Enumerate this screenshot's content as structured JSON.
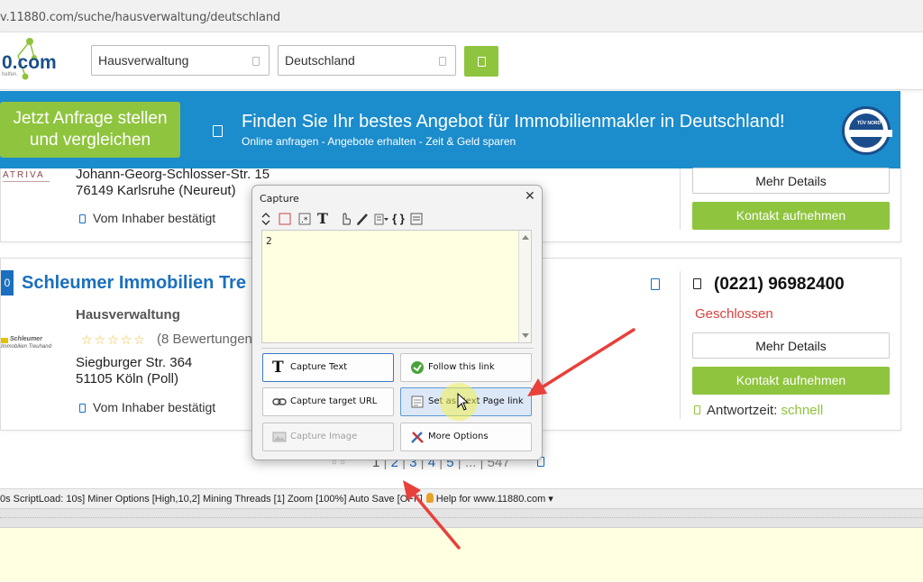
{
  "browser": {
    "url": "v.11880.com/suche/hausverwaltung/deutschland"
  },
  "header": {
    "logo_text": "0.com",
    "logo_tagline": "helfen.",
    "search_what": "Hausverwaltung",
    "search_where": "Deutschland"
  },
  "banner": {
    "button_label_1": "Jetzt Anfrage stellen",
    "button_label_2": "und vergleichen",
    "title": "Finden Sie Ihr bestes Angebot für Immobilienmakler in Deutschland!",
    "subtitle": "Online anfragen - Angebote erhalten - Zeit & Geld sparen",
    "badge_text": "TÜV NORD"
  },
  "listing1": {
    "logo_text": "ATRIVA",
    "street": "Johann-Georg-Schlosser-Str. 15",
    "city": "76149 Karlsruhe (Neureut)",
    "verified": "Vom Inhaber bestätigt",
    "details_button": "Mehr Details",
    "contact_button": "Kontakt aufnehmen"
  },
  "listing2": {
    "number": "0",
    "company": "Schleumer Immobilien Tre",
    "logo_line1": "Schleumer",
    "logo_line2": "Immobilien Treuhand",
    "category": "Hausverwaltung",
    "stars": "☆☆☆☆☆",
    "reviews": "(8 Bewertungen",
    "street": "Siegburger Str. 364",
    "city": "51105 Köln (Poll)",
    "verified": "Vom Inhaber bestätigt",
    "phone": "(0221) 96982400",
    "status": "Geschlossen",
    "details_button": "Mehr Details",
    "contact_button": "Kontakt aufnehmen",
    "response_label": "Antwortzeit:",
    "response_value": "schnell"
  },
  "pagination": {
    "pages": [
      "1",
      "2",
      "3",
      "4",
      "5",
      "...",
      "547"
    ]
  },
  "statusbar": {
    "text": "0s ScriptLoad: 10s] Miner Options [High,10,2] Mining Threads [1] Zoom [100%] Auto Save [OFF]",
    "help": "Help for www.11880.com",
    "help_caret": "▾"
  },
  "dialog": {
    "title": "Capture",
    "close": "✕",
    "content": "2",
    "toolbar_brace": "{ }",
    "toolbar_t": "T",
    "buttons": {
      "capture_text": "Capture Text",
      "follow_link": "Follow this link",
      "capture_url": "Capture target URL",
      "next_page": "Set as Next Page link",
      "capture_image": "Capture Image",
      "more_options": "More Options"
    }
  },
  "colors": {
    "brand_blue": "#1b6fbf",
    "brand_green": "#8fc43e",
    "banner_blue": "#1b8ccc",
    "closed_red": "#d9413e",
    "arrow_red": "#e8403a"
  }
}
